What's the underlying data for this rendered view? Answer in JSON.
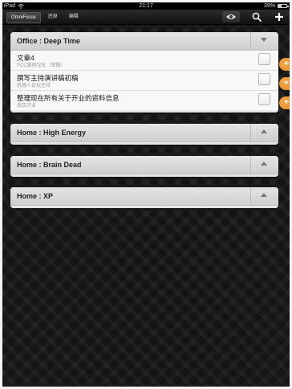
{
  "status_bar": {
    "carrier": "iPad",
    "time": "21:17",
    "battery_text": "39%",
    "battery_level": 0.39
  },
  "toolbar": {
    "tabs": [
      {
        "label": "OmniFocus",
        "active": true
      },
      {
        "label": "还原",
        "active": false
      },
      {
        "label": "编辑",
        "active": false
      }
    ],
    "icons": [
      "eye-icon",
      "search-icon",
      "add-icon"
    ]
  },
  "groups": [
    {
      "title": "Office : Deep Time",
      "expanded": true,
      "tasks": [
        {
          "title": "文章4",
          "subtitle": "PCC案例汉化（荣殷）"
        },
        {
          "title": "撰写主持演讲稿初稿",
          "subtitle": "机器人论坛主持"
        },
        {
          "title": "整理现在所有关于开业的资料信息",
          "subtitle": "南京开业"
        }
      ]
    },
    {
      "title": "Home : High Energy",
      "expanded": false,
      "tasks": []
    },
    {
      "title": "Home : Brain Dead",
      "expanded": false,
      "tasks": []
    },
    {
      "title": "Home : XP",
      "expanded": false,
      "tasks": []
    }
  ],
  "colors": {
    "accent_orange": "#e08a2a",
    "background": "#141414",
    "panel": "#efefef"
  }
}
